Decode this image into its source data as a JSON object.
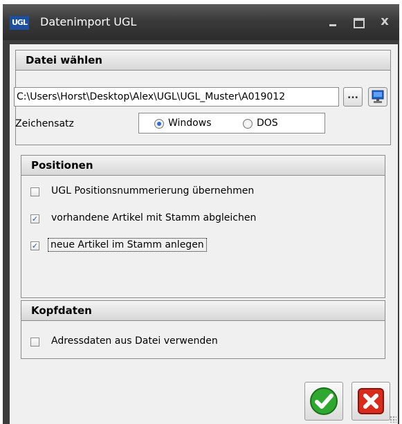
{
  "window": {
    "title": "Datenimport UGL",
    "logo_text": "UGL",
    "close_glyph": "x"
  },
  "datei": {
    "header": "Datei wählen",
    "path": "C:\\Users\\Horst\\Desktop\\Alex\\UGL\\UGL_Muster\\A019012",
    "browse_label": "...",
    "computer_icon": "computer-icon",
    "charset_label": "Zeichensatz",
    "charset_options": [
      {
        "label": "Windows",
        "selected": true
      },
      {
        "label": "DOS",
        "selected": false
      }
    ]
  },
  "positionen": {
    "header": "Positionen",
    "options": [
      {
        "label": "UGL Positionsnummerierung übernehmen",
        "checked": false
      },
      {
        "label": "vorhandene Artikel mit Stamm abgleichen",
        "checked": true
      },
      {
        "label": "neue Artikel im Stamm anlegen",
        "checked": true
      }
    ]
  },
  "kopfdaten": {
    "header": "Kopfdaten",
    "options": [
      {
        "label": "Adressdaten aus Datei verwenden",
        "checked": false
      }
    ]
  },
  "buttons": {
    "ok_icon": "checkmark-icon",
    "cancel_icon": "cross-icon"
  },
  "colors": {
    "titlebar": "#3a3a3a",
    "ok_green": "#2ea82e",
    "cancel_red": "#d92a1e",
    "check_blue": "#2255aa"
  }
}
